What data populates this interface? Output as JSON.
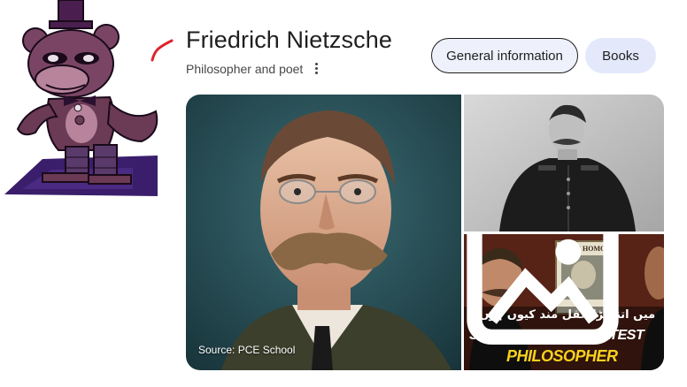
{
  "entity": {
    "title": "Friedrich Nietzsche",
    "subtitle": "Philosopher and poet"
  },
  "chips": {
    "general": "General information",
    "books": "Books"
  },
  "images": {
    "main_source": "Source: PCE School",
    "thumb_book_title": "ECCE HOMO",
    "thumb_caption_urdu": "میں اتنا بڑا عقل مند کیوں ہوں؟",
    "thumb_caption_line1": "STORY OF THE GREATEST",
    "thumb_caption_line2": "PHILOSOPHER"
  },
  "colors": {
    "chip_active_bg": "#eef1fb",
    "chip_bg": "#e3e9fb",
    "mascot_body": "#6b3a55",
    "stroke_red": "#e0232d",
    "caption_yellow": "#f7d21c"
  },
  "icons": {
    "more": "more-vert-icon",
    "image": "image-icon"
  }
}
